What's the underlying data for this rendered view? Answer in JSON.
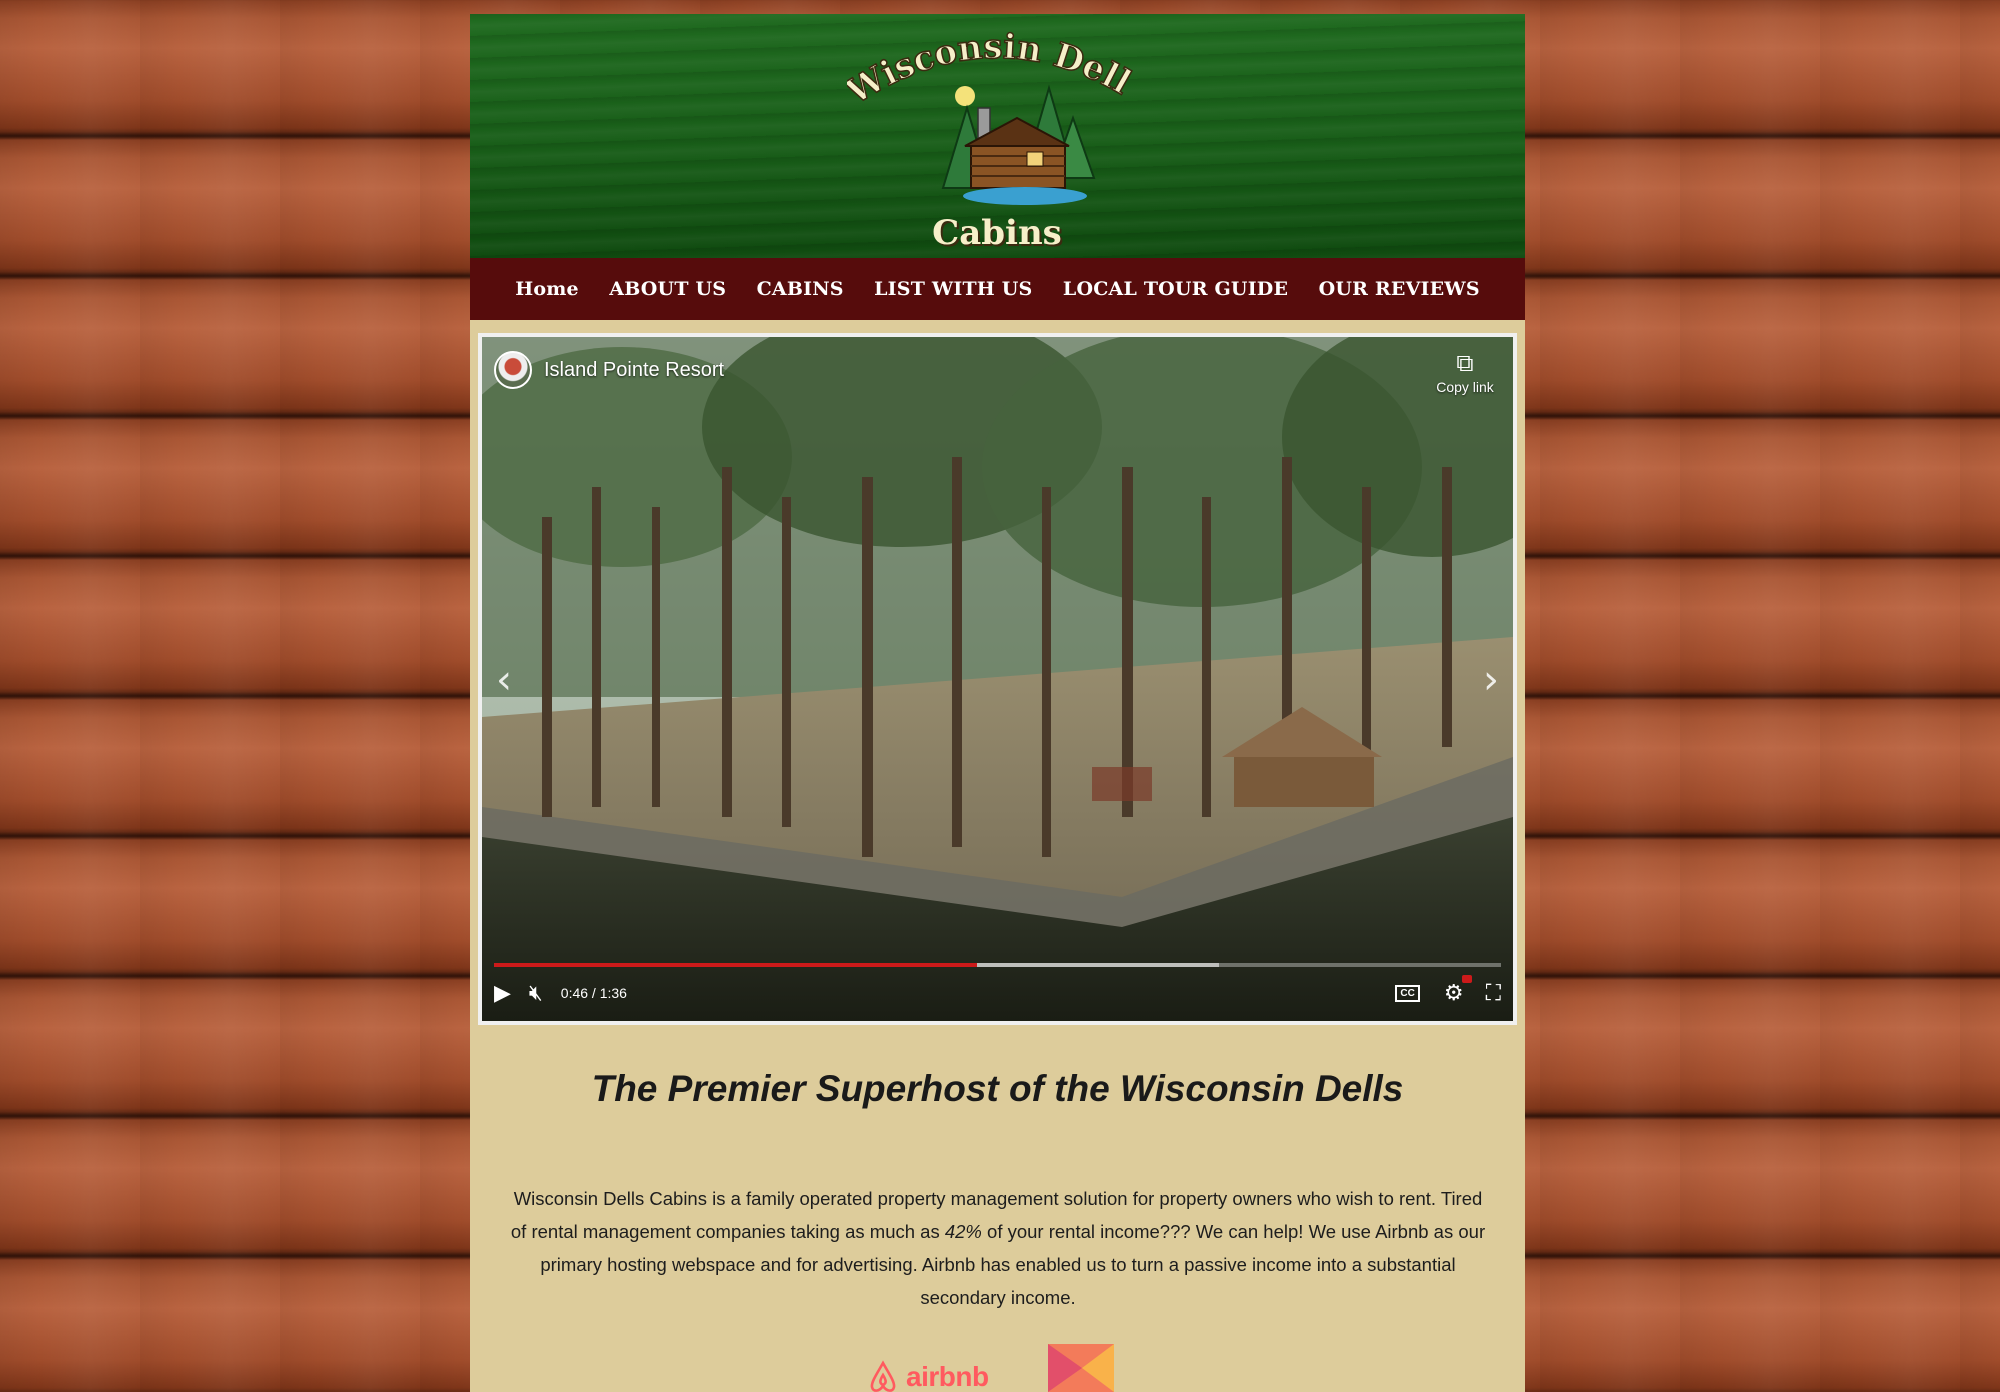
{
  "site": {
    "logo_title": "Wisconsin Dells",
    "logo_subtitle": "Cabins"
  },
  "nav": {
    "items": [
      "Home",
      "ABOUT US",
      "CABINS",
      "LIST WITH US",
      "LOCAL TOUR GUIDE",
      "OUR REVIEWS"
    ]
  },
  "video": {
    "channel_title": "Island Pointe Resort",
    "copy_link_label": "Copy link",
    "time": "0:46 / 1:36",
    "progress_played_fraction": 0.48,
    "progress_buffered_fraction": 0.72,
    "cc_label": "CC"
  },
  "content": {
    "headline": "The Premier Superhost of the Wisconsin Dells",
    "intro_part1": "Wisconsin Dells Cabins is a family operated property management solution for property owners who wish to rent. Tired of rental management companies taking as much as ",
    "intro_emphasis": "42%",
    "intro_part2": " of your rental income??? We can help! We use Airbnb as our primary hosting webspace and for advertising. Airbnb has enabled us to turn a passive income into a substantial secondary income.",
    "partner_logo_text": "airbnb"
  },
  "colors": {
    "header_green": "#1a5f1a",
    "nav_maroon": "#560c0c",
    "content_tan": "#ddcc9b",
    "progress_red": "#cc1a1a",
    "airbnb_coral": "#ff5a5f"
  },
  "icons": [
    "log-cabin-logo-icon",
    "copy-icon",
    "chevron-left-icon",
    "chevron-right-icon",
    "play-icon",
    "mute-icon",
    "cc-icon",
    "settings-gear-icon",
    "fullscreen-icon",
    "airbnb-icon",
    "vrbo-icon"
  ]
}
